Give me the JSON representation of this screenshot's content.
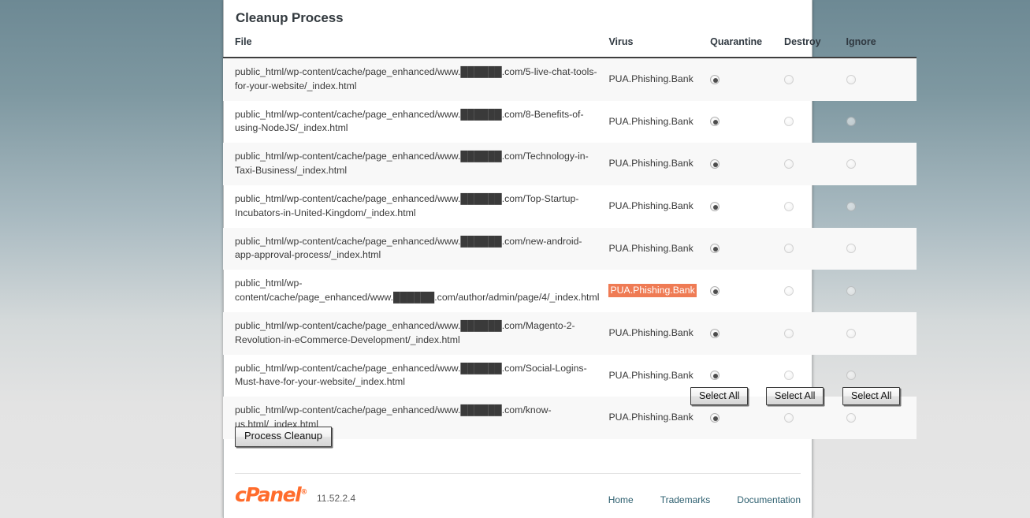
{
  "page": {
    "title": "Cleanup Process"
  },
  "table": {
    "headers": {
      "file": "File",
      "virus": "Virus",
      "quarantine": "Quarantine",
      "destroy": "Destroy",
      "ignore": "Ignore"
    },
    "rows": [
      {
        "file": "public_html/wp-content/cache/page_enhanced/www.██████.com/5-live-chat-tools-for-your-website/_index.html",
        "virus": "PUA.Phishing.Bank",
        "virus_highlighted": false,
        "quarantine_checked": true,
        "destroy_checked": false,
        "ignore_checked": false
      },
      {
        "file": "public_html/wp-content/cache/page_enhanced/www.██████.com/8-Benefits-of-using-NodeJS/_index.html",
        "virus": "PUA.Phishing.Bank",
        "virus_highlighted": false,
        "quarantine_checked": true,
        "destroy_checked": false,
        "ignore_checked": false
      },
      {
        "file": "public_html/wp-content/cache/page_enhanced/www.██████.com/Technology-in-Taxi-Business/_index.html",
        "virus": "PUA.Phishing.Bank",
        "virus_highlighted": false,
        "quarantine_checked": true,
        "destroy_checked": false,
        "ignore_checked": false
      },
      {
        "file": "public_html/wp-content/cache/page_enhanced/www.██████.com/Top-Startup-Incubators-in-United-Kingdom/_index.html",
        "virus": "PUA.Phishing.Bank",
        "virus_highlighted": false,
        "quarantine_checked": true,
        "destroy_checked": false,
        "ignore_checked": false
      },
      {
        "file": "public_html/wp-content/cache/page_enhanced/www.██████.com/new-android-app-approval-process/_index.html",
        "virus": "PUA.Phishing.Bank",
        "virus_highlighted": false,
        "quarantine_checked": true,
        "destroy_checked": false,
        "ignore_checked": false
      },
      {
        "file": "public_html/wp-content/cache/page_enhanced/www.██████.com/author/admin/page/4/_index.html",
        "virus": "PUA.Phishing.Bank",
        "virus_highlighted": true,
        "quarantine_checked": true,
        "destroy_checked": false,
        "ignore_checked": false
      },
      {
        "file": "public_html/wp-content/cache/page_enhanced/www.██████.com/Magento-2-Revolution-in-eCommerce-Development/_index.html",
        "virus": "PUA.Phishing.Bank",
        "virus_highlighted": false,
        "quarantine_checked": true,
        "destroy_checked": false,
        "ignore_checked": false
      },
      {
        "file": "public_html/wp-content/cache/page_enhanced/www.██████.com/Social-Logins-Must-have-for-your-website/_index.html",
        "virus": "PUA.Phishing.Bank",
        "virus_highlighted": false,
        "quarantine_checked": true,
        "destroy_checked": false,
        "ignore_checked": false
      },
      {
        "file": "public_html/wp-content/cache/page_enhanced/www.██████.com/know-us.html/_index.html",
        "virus": "PUA.Phishing.Bank",
        "virus_highlighted": false,
        "quarantine_checked": true,
        "destroy_checked": false,
        "ignore_checked": false
      }
    ]
  },
  "actions": {
    "select_all_quarantine": "Select All",
    "select_all_destroy": "Select All",
    "select_all_ignore": "Select All",
    "process_cleanup": "Process Cleanup"
  },
  "footer": {
    "logo": "cPanel",
    "logo_tm": "®",
    "version": "11.52.2.4",
    "links": [
      {
        "label": "Home"
      },
      {
        "label": "Trademarks"
      },
      {
        "label": "Documentation"
      }
    ]
  },
  "colors": {
    "highlight_bg": "#ef7b54",
    "highlight_fg": "#ffffff",
    "logo_orange": "#ff6c2c",
    "link": "#2e6070",
    "row_stripe": "#f8f8f8",
    "header_rule": "#3e3e3e"
  }
}
